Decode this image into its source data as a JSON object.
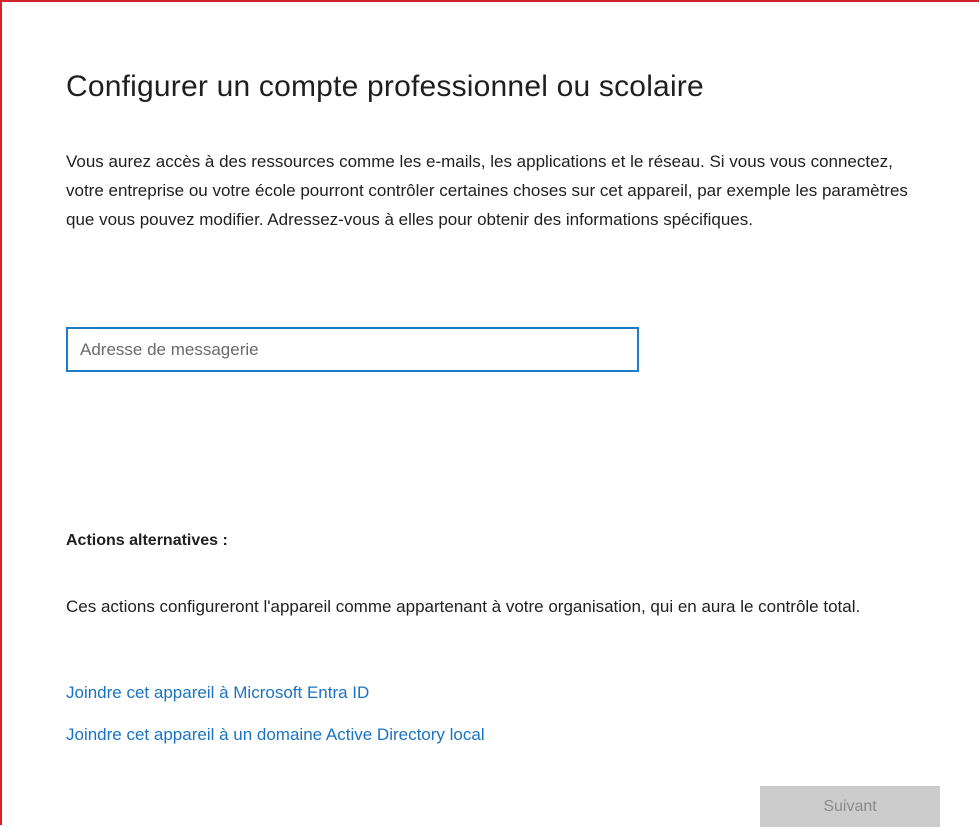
{
  "page": {
    "title": "Configurer un compte professionnel ou scolaire",
    "description": "Vous aurez accès à des ressources comme les e-mails, les applications et le réseau. Si vous vous connectez, votre entreprise ou votre école pourront contrôler certaines choses sur cet appareil, par exemple les paramètres que vous pouvez modifier. Adressez-vous à elles pour obtenir des informations spécifiques."
  },
  "email": {
    "value": "",
    "placeholder": "Adresse de messagerie"
  },
  "alternatives": {
    "heading": "Actions alternatives :",
    "description": "Ces actions configureront l'appareil comme appartenant à votre organisation, qui en aura le contrôle total.",
    "links": [
      {
        "label": "Joindre cet appareil à Microsoft Entra ID"
      },
      {
        "label": "Joindre cet appareil à un domaine Active Directory local"
      }
    ]
  },
  "footer": {
    "next_label": "Suivant",
    "next_enabled": false
  },
  "colors": {
    "frame_border": "#d2232a",
    "input_border": "#1f7bc8",
    "link": "#1a73c2",
    "button_disabled_bg": "#cccccc",
    "button_disabled_text": "#8a8a8a"
  }
}
